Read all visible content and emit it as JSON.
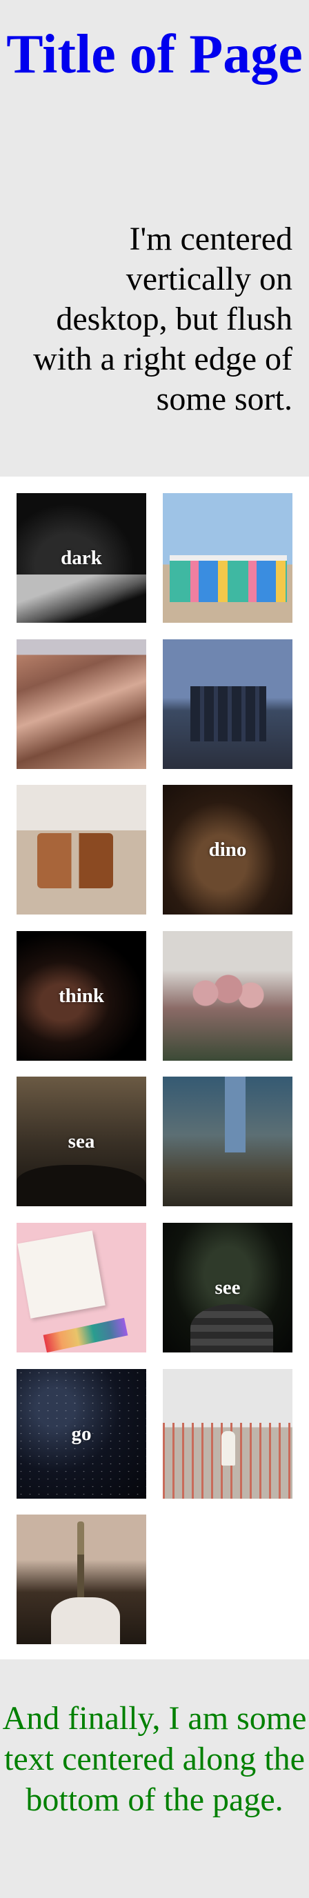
{
  "header": {
    "title": "Title of Page",
    "intro": "I'm centered vertically on desktop, but flush with a right edge of some sort."
  },
  "gallery": {
    "tiles": [
      {
        "label": "dark"
      },
      {
        "label": ""
      },
      {
        "label": ""
      },
      {
        "label": ""
      },
      {
        "label": ""
      },
      {
        "label": "dino"
      },
      {
        "label": "think"
      },
      {
        "label": ""
      },
      {
        "label": "sea"
      },
      {
        "label": ""
      },
      {
        "label": ""
      },
      {
        "label": "see"
      },
      {
        "label": "go"
      },
      {
        "label": ""
      },
      {
        "label": ""
      }
    ]
  },
  "footer": {
    "text": "And finally, I am some text centered along the bottom of the page."
  },
  "colors": {
    "title": "#0000ee",
    "footer_text": "#008000",
    "panel_bg": "#e9e9e9"
  }
}
